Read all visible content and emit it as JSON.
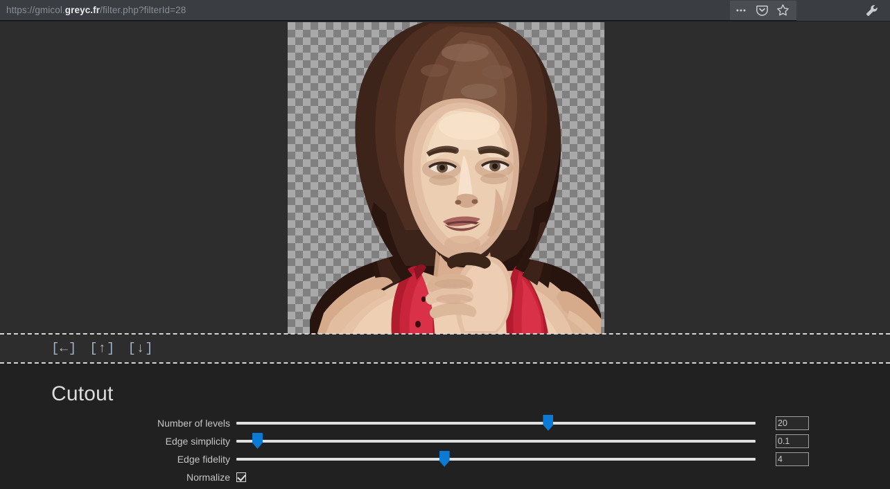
{
  "browser": {
    "url_full": "https://gmicol.greyc.fr/filter.php?filterId=28",
    "url_scheme": "https://gmicol.",
    "url_domain": "greyc.fr",
    "url_path": "/filter.php?filterId=28",
    "icons": {
      "more": "more-horizontal-icon",
      "pocket": "pocket-shield-icon",
      "bookmark": "star-icon",
      "tools": "wrench-icon"
    }
  },
  "preview": {
    "alt": "Posterized cutout-filter portrait of a woman with long dark hair wearing a red top, shown over a transparency checkerboard",
    "checker_light": "#a9a9a9",
    "checker_dark": "#808080"
  },
  "navigation": {
    "buttons": [
      {
        "name": "back",
        "label": "[←]"
      },
      {
        "name": "up",
        "label": "[↑]"
      },
      {
        "name": "down",
        "label": "[↓]"
      }
    ]
  },
  "filter": {
    "title": "Cutout",
    "accent_color": "#0b7ad4",
    "parameters": [
      {
        "id": "levels",
        "label": "Number of levels",
        "value": "20",
        "percent": 60
      },
      {
        "id": "simplicity",
        "label": "Edge simplicity",
        "value": "0.1",
        "percent": 4
      },
      {
        "id": "fidelity",
        "label": "Edge fidelity",
        "value": "4",
        "percent": 40
      }
    ],
    "checkbox": {
      "id": "normalize",
      "label": "Normalize",
      "checked": true
    }
  }
}
